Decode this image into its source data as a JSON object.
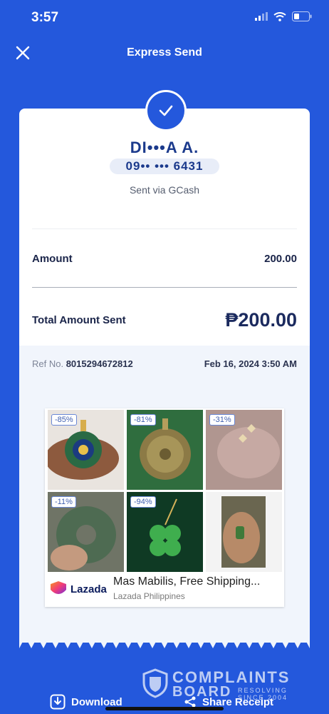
{
  "status_bar": {
    "time": "3:57"
  },
  "header": {
    "title": "Express Send"
  },
  "recipient": {
    "name": "DI•••A A.",
    "number": "09•• ••• 6431",
    "sent_via": "Sent via GCash"
  },
  "amount": {
    "label": "Amount",
    "value": "200.00"
  },
  "total": {
    "label": "Total Amount Sent",
    "value": "₱200.00"
  },
  "reference": {
    "label": "Ref No.",
    "number": "8015294672812",
    "datetime": "Feb 16, 2024 3:50 AM"
  },
  "ad": {
    "badges": [
      "-85%",
      "-81%",
      "-31%",
      "-11%",
      "-94%"
    ],
    "brand": "Lazada",
    "title": "Mas Mabilis, Free Shipping...",
    "subtitle": "Lazada Philippines",
    "info_icon": "i",
    "close_icon": "✕"
  },
  "actions": {
    "download": "Download",
    "share": "Share Receipt"
  },
  "watermark": {
    "line1": "COMPLAINTS",
    "line2": "BOARD",
    "tag1": "RESOLVING",
    "tag2": "SINCE 2004"
  },
  "colors": {
    "primary": "#2458dc",
    "text": "#1a2449",
    "band": "#f1f5fc"
  }
}
